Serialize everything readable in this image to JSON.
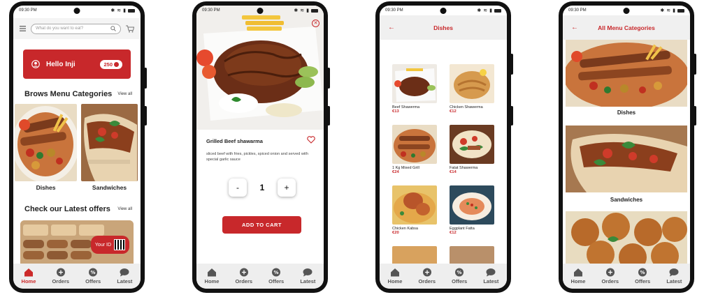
{
  "status": {
    "time": "09:30 PM"
  },
  "nav": [
    {
      "label": "Home",
      "icon": "home-icon"
    },
    {
      "label": "Orders",
      "icon": "plus-circle-icon"
    },
    {
      "label": "Offers",
      "icon": "percent-icon"
    },
    {
      "label": "Latest",
      "icon": "chat-bubble-icon"
    }
  ],
  "home": {
    "search_placeholder": "What do you want to eat?",
    "greeting": "Hello Inji",
    "points": "250",
    "categories_title": "Brows Menu Categories",
    "view_all": "View all",
    "categories": [
      "Dishes",
      "Sandwiches"
    ],
    "offers_title": "Check our Latest offers",
    "offers_view_all": "View all",
    "your_id": "Your ID"
  },
  "detail": {
    "title": "Grilled Beef shawarma",
    "description": "sliced beef with fries, pickles, spiced onion and served with special garlic sauce",
    "minus": "-",
    "quantity": "1",
    "plus": "+",
    "add_to_cart": "ADD TO CART"
  },
  "dishes": {
    "title": "Dishes",
    "items": [
      {
        "name": "Beef Shawerma",
        "price": "€13"
      },
      {
        "name": "Chicken Shawerma",
        "price": "€12"
      },
      {
        "name": "1 Kg Mixed Grill",
        "price": "€24"
      },
      {
        "name": "Fatat Shawerma",
        "price": "€14"
      },
      {
        "name": "Chicken Kabsa",
        "price": "€20"
      },
      {
        "name": "Eggplant Fatta",
        "price": "€12"
      }
    ]
  },
  "all_categories": {
    "title": "All Menu Categories",
    "items": [
      "Dishes",
      "Sandwiches"
    ]
  },
  "colors": {
    "brand_red": "#c8282b",
    "nav_bg": "#eeeeee"
  }
}
